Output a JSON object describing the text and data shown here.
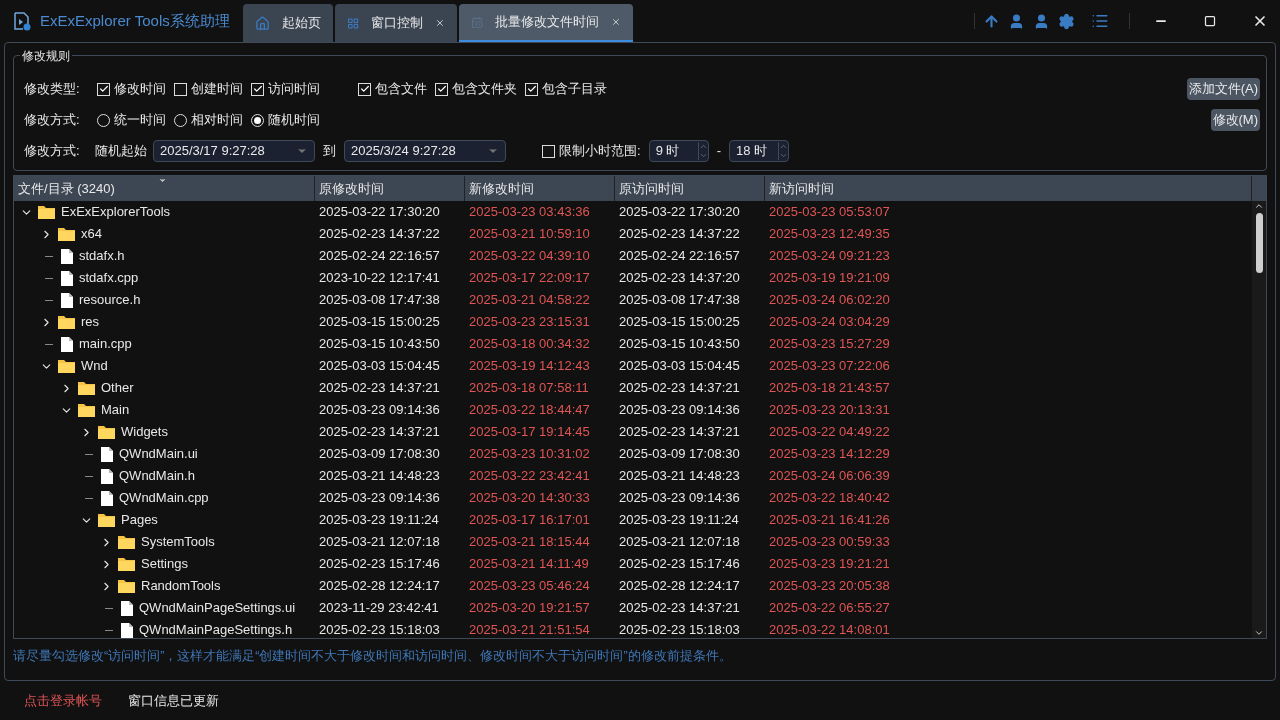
{
  "window": {
    "title": "ExExExplorer Tools系统助理"
  },
  "tabs": [
    {
      "label": "起始页",
      "selected": false,
      "closable": false
    },
    {
      "label": "窗口控制",
      "selected": false,
      "closable": true
    },
    {
      "label": "批量修改文件时间",
      "selected": true,
      "closable": true
    }
  ],
  "rules": {
    "title": "修改规则",
    "type_label": "修改类型:",
    "types": [
      {
        "label": "修改时间",
        "checked": true
      },
      {
        "label": "创建时间",
        "checked": false
      },
      {
        "label": "访问时间",
        "checked": true
      }
    ],
    "includes": [
      {
        "label": "包含文件",
        "checked": true
      },
      {
        "label": "包含文件夹",
        "checked": true
      },
      {
        "label": "包含子目录",
        "checked": true
      }
    ],
    "mode_label": "修改方式:",
    "modes": [
      {
        "label": "统一时间",
        "selected": false
      },
      {
        "label": "相对时间",
        "selected": false
      },
      {
        "label": "随机时间",
        "selected": true
      }
    ],
    "range_label": "修改方式:",
    "range_start_label": "随机起始",
    "range_start": "2025/3/17 9:27:28",
    "range_to": "到",
    "range_end": "2025/3/24 9:27:28",
    "hour_limit": {
      "label": "限制小时范围:",
      "checked": false
    },
    "hour_from": "9 时",
    "hour_sep": "-",
    "hour_to": "18 时",
    "add_button": "添加文件(A)",
    "modify_button": "修改(M)"
  },
  "table": {
    "columns": [
      "文件/目录 (3240)",
      "原修改时间",
      "新修改时间",
      "原访问时间",
      "新访问时间"
    ],
    "rows": [
      {
        "name": "ExExExplorerTools",
        "kind": "folder",
        "expanded": true,
        "times": [
          "2025-03-22 17:30:20",
          "2025-03-23 03:43:36",
          "2025-03-22 17:30:20",
          "2025-03-23 05:53:07"
        ],
        "children": [
          {
            "name": "x64",
            "kind": "folder",
            "expanded": false,
            "times": [
              "2025-02-23 14:37:22",
              "2025-03-21 10:59:10",
              "2025-02-23 14:37:22",
              "2025-03-23 12:49:35"
            ]
          },
          {
            "name": "stdafx.h",
            "kind": "file",
            "times": [
              "2025-02-24 22:16:57",
              "2025-03-22 04:39:10",
              "2025-02-24 22:16:57",
              "2025-03-24 09:21:23"
            ]
          },
          {
            "name": "stdafx.cpp",
            "kind": "file",
            "times": [
              "2023-10-22 12:17:41",
              "2025-03-17 22:09:17",
              "2025-02-23 14:37:20",
              "2025-03-19 19:21:09"
            ]
          },
          {
            "name": "resource.h",
            "kind": "file",
            "times": [
              "2025-03-08 17:47:38",
              "2025-03-21 04:58:22",
              "2025-03-08 17:47:38",
              "2025-03-24 06:02:20"
            ]
          },
          {
            "name": "res",
            "kind": "folder",
            "expanded": false,
            "times": [
              "2025-03-15 15:00:25",
              "2025-03-23 23:15:31",
              "2025-03-15 15:00:25",
              "2025-03-24 03:04:29"
            ]
          },
          {
            "name": "main.cpp",
            "kind": "file",
            "times": [
              "2025-03-15 10:43:50",
              "2025-03-18 00:34:32",
              "2025-03-15 10:43:50",
              "2025-03-23 15:27:29"
            ]
          },
          {
            "name": "Wnd",
            "kind": "folder",
            "expanded": true,
            "times": [
              "2025-03-03 15:04:45",
              "2025-03-19 14:12:43",
              "2025-03-03 15:04:45",
              "2025-03-23 07:22:06"
            ],
            "children": [
              {
                "name": "Other",
                "kind": "folder",
                "expanded": false,
                "times": [
                  "2025-02-23 14:37:21",
                  "2025-03-18 07:58:11",
                  "2025-02-23 14:37:21",
                  "2025-03-18 21:43:57"
                ]
              },
              {
                "name": "Main",
                "kind": "folder",
                "expanded": true,
                "times": [
                  "2025-03-23 09:14:36",
                  "2025-03-22 18:44:47",
                  "2025-03-23 09:14:36",
                  "2025-03-23 20:13:31"
                ],
                "children": [
                  {
                    "name": "Widgets",
                    "kind": "folder",
                    "expanded": false,
                    "times": [
                      "2025-02-23 14:37:21",
                      "2025-03-17 19:14:45",
                      "2025-02-23 14:37:21",
                      "2025-03-22 04:49:22"
                    ]
                  },
                  {
                    "name": "QWndMain.ui",
                    "kind": "file",
                    "times": [
                      "2025-03-09 17:08:30",
                      "2025-03-23 10:31:02",
                      "2025-03-09 17:08:30",
                      "2025-03-23 14:12:29"
                    ]
                  },
                  {
                    "name": "QWndMain.h",
                    "kind": "file",
                    "times": [
                      "2025-03-21 14:48:23",
                      "2025-03-22 23:42:41",
                      "2025-03-21 14:48:23",
                      "2025-03-24 06:06:39"
                    ]
                  },
                  {
                    "name": "QWndMain.cpp",
                    "kind": "file",
                    "times": [
                      "2025-03-23 09:14:36",
                      "2025-03-20 14:30:33",
                      "2025-03-23 09:14:36",
                      "2025-03-22 18:40:42"
                    ]
                  },
                  {
                    "name": "Pages",
                    "kind": "folder",
                    "expanded": true,
                    "times": [
                      "2025-03-23 19:11:24",
                      "2025-03-17 16:17:01",
                      "2025-03-23 19:11:24",
                      "2025-03-21 16:41:26"
                    ],
                    "children": [
                      {
                        "name": "SystemTools",
                        "kind": "folder",
                        "expanded": false,
                        "times": [
                          "2025-03-21 12:07:18",
                          "2025-03-21 18:15:44",
                          "2025-03-21 12:07:18",
                          "2025-03-23 00:59:33"
                        ]
                      },
                      {
                        "name": "Settings",
                        "kind": "folder",
                        "expanded": false,
                        "times": [
                          "2025-02-23 15:17:46",
                          "2025-03-21 14:11:49",
                          "2025-02-23 15:17:46",
                          "2025-03-23 19:21:21"
                        ]
                      },
                      {
                        "name": "RandomTools",
                        "kind": "folder",
                        "expanded": false,
                        "times": [
                          "2025-02-28 12:24:17",
                          "2025-03-23 05:46:24",
                          "2025-02-28 12:24:17",
                          "2025-03-23 20:05:38"
                        ]
                      },
                      {
                        "name": "QWndMainPageSettings.ui",
                        "kind": "file",
                        "times": [
                          "2023-11-29 23:42:41",
                          "2025-03-20 19:21:57",
                          "2025-02-23 14:37:21",
                          "2025-03-22 06:55:27"
                        ]
                      },
                      {
                        "name": "QWndMainPageSettings.h",
                        "kind": "file",
                        "times": [
                          "2025-02-23 15:18:03",
                          "2025-03-21 21:51:54",
                          "2025-02-23 15:18:03",
                          "2025-03-22 14:08:01"
                        ]
                      }
                    ]
                  }
                ]
              }
            ]
          }
        ]
      }
    ]
  },
  "hint": "请尽量勾选修改“访问时间”，这样才能满足“创建时间不大于修改时间和访问时间、修改时间不大于访问时间”的修改前提条件。",
  "status_bar": {
    "login": "点击登录帐号",
    "message": "窗口信息已更新"
  }
}
